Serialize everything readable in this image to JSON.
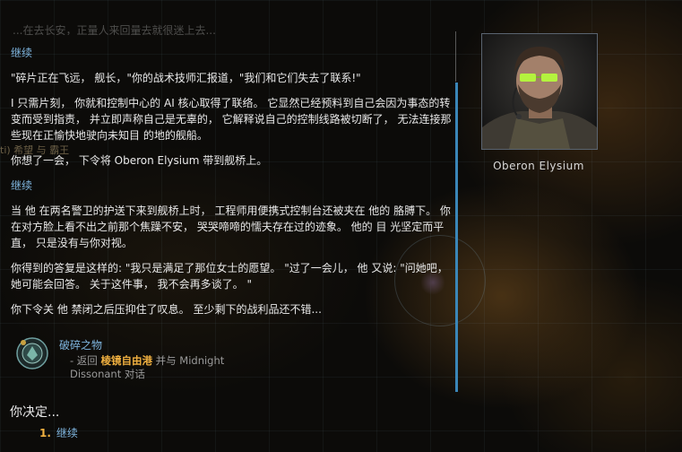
{
  "background": {
    "faded_top_text": "...在去长安，正量人来回量去就很迷上去...",
    "side_label": "ti) 希望 与 霸王"
  },
  "dialog": {
    "continue_1": "继续",
    "line_1": "\"碎片正在飞远， 舰长，\"你的战术技师汇报道，\"我们和它们失去了联系!\"",
    "line_2": "I 只需片刻， 你就和控制中心的 AI 核心取得了联络。 它显然已经预料到自己会因为事态的转变而受到指责， 并立即声称自己是无辜的， 它解释说自己的控制线路被切断了， 无法连接那些现在正愉快地驶向未知目 的地的舰船。",
    "line_3": "你想了一会， 下令将 Oberon Elysium 带到舰桥上。",
    "continue_2": "继续",
    "line_4": "当 他 在两名警卫的护送下来到舰桥上时， 工程师用便携式控制台还被夹在 他的 胳膊下。 你在对方脸上看不出之前那个焦躁不安， 哭哭啼啼的懦夫存在过的迹象。 他的 目 光坚定而平直， 只是没有与你对视。",
    "line_5": "你得到的答复是这样的: \"我只是满足了那位女士的愿望。 \"过了一会儿， 他 又说: \"问她吧， 她可能会回答。 关于这件事， 我不会再多谈了。 \"",
    "line_6": "你下令关 他 禁闭之后压抑住了叹息。 至少剩下的战利品还不错..."
  },
  "quest": {
    "title": "破碎之物",
    "desc_prefix": "- 返回 ",
    "desc_location": "棱镜自由港",
    "desc_suffix": " 并与 Midnight Dissonant 对话",
    "icon": "quest-token-icon"
  },
  "portrait": {
    "name": "Oberon Elysium"
  },
  "decision": {
    "heading": "你决定...",
    "options": [
      {
        "number": "1.",
        "label": "继续"
      }
    ]
  },
  "colors": {
    "link": "#7fb6e0",
    "highlight": "#f0b040",
    "scrollbar": "#3a86b8",
    "text": "#e9e9e9"
  }
}
